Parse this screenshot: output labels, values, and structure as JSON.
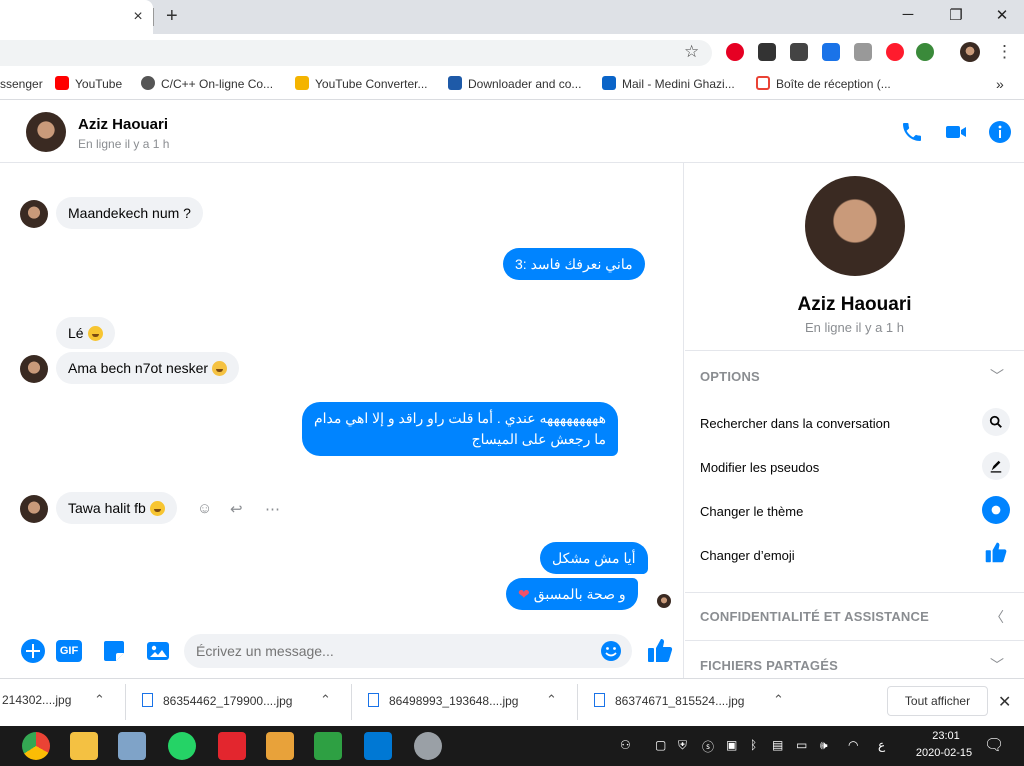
{
  "browser": {
    "tab_close": "×",
    "new_tab": "+",
    "minimize": "─",
    "maximize": "❐",
    "close": "✕",
    "star": "☆",
    "menu": "⋮"
  },
  "bookmarks": [
    {
      "label": "ssenger",
      "color": "#ffffff"
    },
    {
      "label": "YouTube",
      "color": "#ff0000"
    },
    {
      "label": "C/C++ On-ligne Co...",
      "color": "#555555"
    },
    {
      "label": "YouTube Converter...",
      "color": "#f4b400"
    },
    {
      "label": "Downloader and co...",
      "color": "#1e5aa8"
    },
    {
      "label": "Mail - Medini Ghazi...",
      "color": "#0a64c8"
    },
    {
      "label": "Boîte de réception (...",
      "color": "#ea4335"
    }
  ],
  "bookmarks_more": "»",
  "header": {
    "name": "Aziz Haouari",
    "status": "En ligne il y a 1 h"
  },
  "messages": [
    {
      "from": "in",
      "text": "Maandekech num ?"
    },
    {
      "from": "out",
      "text": "ماني نعرفك فاسد :3"
    },
    {
      "from": "in",
      "text": "Lé"
    },
    {
      "from": "in",
      "text": "Ama bech n7ot nesker"
    },
    {
      "from": "out",
      "text": "هههههههههه عندي . أما قلت راو راقد و إلا اهي مدام"
    },
    {
      "from": "out",
      "text": "ما رجعش على الميساج"
    },
    {
      "from": "in",
      "text": "Tawa halit fb"
    },
    {
      "from": "out",
      "text": "أيا مش مشكل"
    },
    {
      "from": "out",
      "text": "و صحة بالمسبق"
    }
  ],
  "message_actions": {
    "react": "☺",
    "reply": "↩",
    "more": "⋯"
  },
  "composer": {
    "placeholder": "Écrivez un message...",
    "gif": "GIF"
  },
  "panel": {
    "name": "Aziz Haouari",
    "status": "En ligne il y a 1 h",
    "options_title": "OPTIONS",
    "options": [
      {
        "label": "Rechercher dans la conversation",
        "icon": "search-icon"
      },
      {
        "label": "Modifier les pseudos",
        "icon": "pencil-icon"
      },
      {
        "label": "Changer le thème",
        "icon": "theme-icon"
      },
      {
        "label": "Changer d’emoji",
        "icon": "thumbs-up-icon"
      }
    ],
    "privacy_title": "CONFIDENTIALITÉ ET ASSISTANCE",
    "files_title": "FICHIERS PARTAGÉS"
  },
  "downloads": {
    "items": [
      "214302....jpg",
      "86354462_179900....jpg",
      "86498993_193648....jpg",
      "86374671_815524....jpg"
    ],
    "show_all": "Tout afficher",
    "close": "✕",
    "chevron": "⌃"
  },
  "taskbar": {
    "time": "23:01",
    "date": "2020-02-15",
    "lang": "ع"
  },
  "colors": {
    "accent": "#0084ff",
    "bubble_in": "#f0f2f5",
    "taskbar": "#1a1a1a"
  }
}
